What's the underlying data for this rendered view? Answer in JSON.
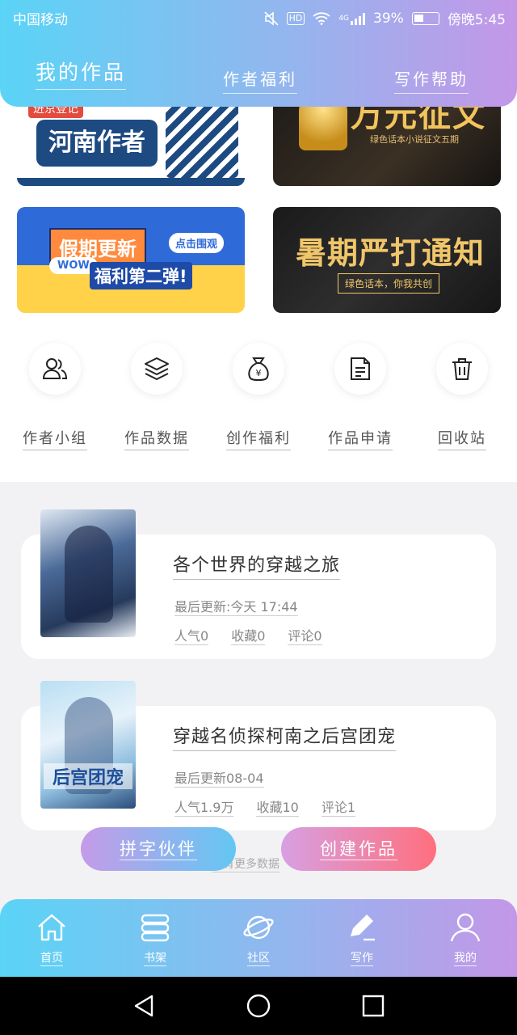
{
  "status_bar": {
    "carrier": "中国移动",
    "network": "4G",
    "hd": "HD",
    "battery": "39%",
    "time": "傍晚5:45"
  },
  "tabs": [
    {
      "label": "我的作品",
      "active": true
    },
    {
      "label": "作者福利",
      "active": false
    },
    {
      "label": "写作帮助",
      "active": false
    }
  ],
  "banners": {
    "henan": {
      "tag": "进京登记",
      "title": "河南作者"
    },
    "contest": {
      "title": "万元征文",
      "subtitle": "绿色话本小说征文五期"
    },
    "holiday": {
      "title": "假期更新",
      "tag": "点击围观",
      "wow": "WOW",
      "subtitle": "福利第二弹!"
    },
    "summer": {
      "title": "暑期严打通知",
      "subtitle": "绿色话本，你我共创"
    }
  },
  "quick_actions": [
    {
      "label": "作者小组",
      "icon": "group-icon"
    },
    {
      "label": "作品数据",
      "icon": "layers-icon"
    },
    {
      "label": "创作福利",
      "icon": "money-bag-icon"
    },
    {
      "label": "作品申请",
      "icon": "document-icon"
    },
    {
      "label": "回收站",
      "icon": "trash-icon"
    }
  ],
  "works": [
    {
      "title": "各个世界的穿越之旅",
      "updated": "最后更新:今天 17:44",
      "popularity": "人气0",
      "favorites": "收藏0",
      "comments": "评论0"
    },
    {
      "title": "穿越名侦探柯南之后宫团宠",
      "updated": "最后更新08-04",
      "popularity": "人气1.9万",
      "favorites": "收藏10",
      "comments": "评论1",
      "cover_text": "后宫团宠"
    }
  ],
  "buttons": {
    "partner": "拼字伙伴",
    "create": "创建作品"
  },
  "no_more": "没有更多数据",
  "bottom_nav": [
    {
      "label": "首页",
      "icon": "home-icon"
    },
    {
      "label": "书架",
      "icon": "bookshelf-icon"
    },
    {
      "label": "社区",
      "icon": "planet-icon"
    },
    {
      "label": "写作",
      "icon": "pen-icon"
    },
    {
      "label": "我的",
      "icon": "user-icon"
    }
  ],
  "colors": {
    "gradient_start": "#5ad4f6",
    "gradient_end": "#c397e8",
    "create_button": "#ff6f7e"
  }
}
